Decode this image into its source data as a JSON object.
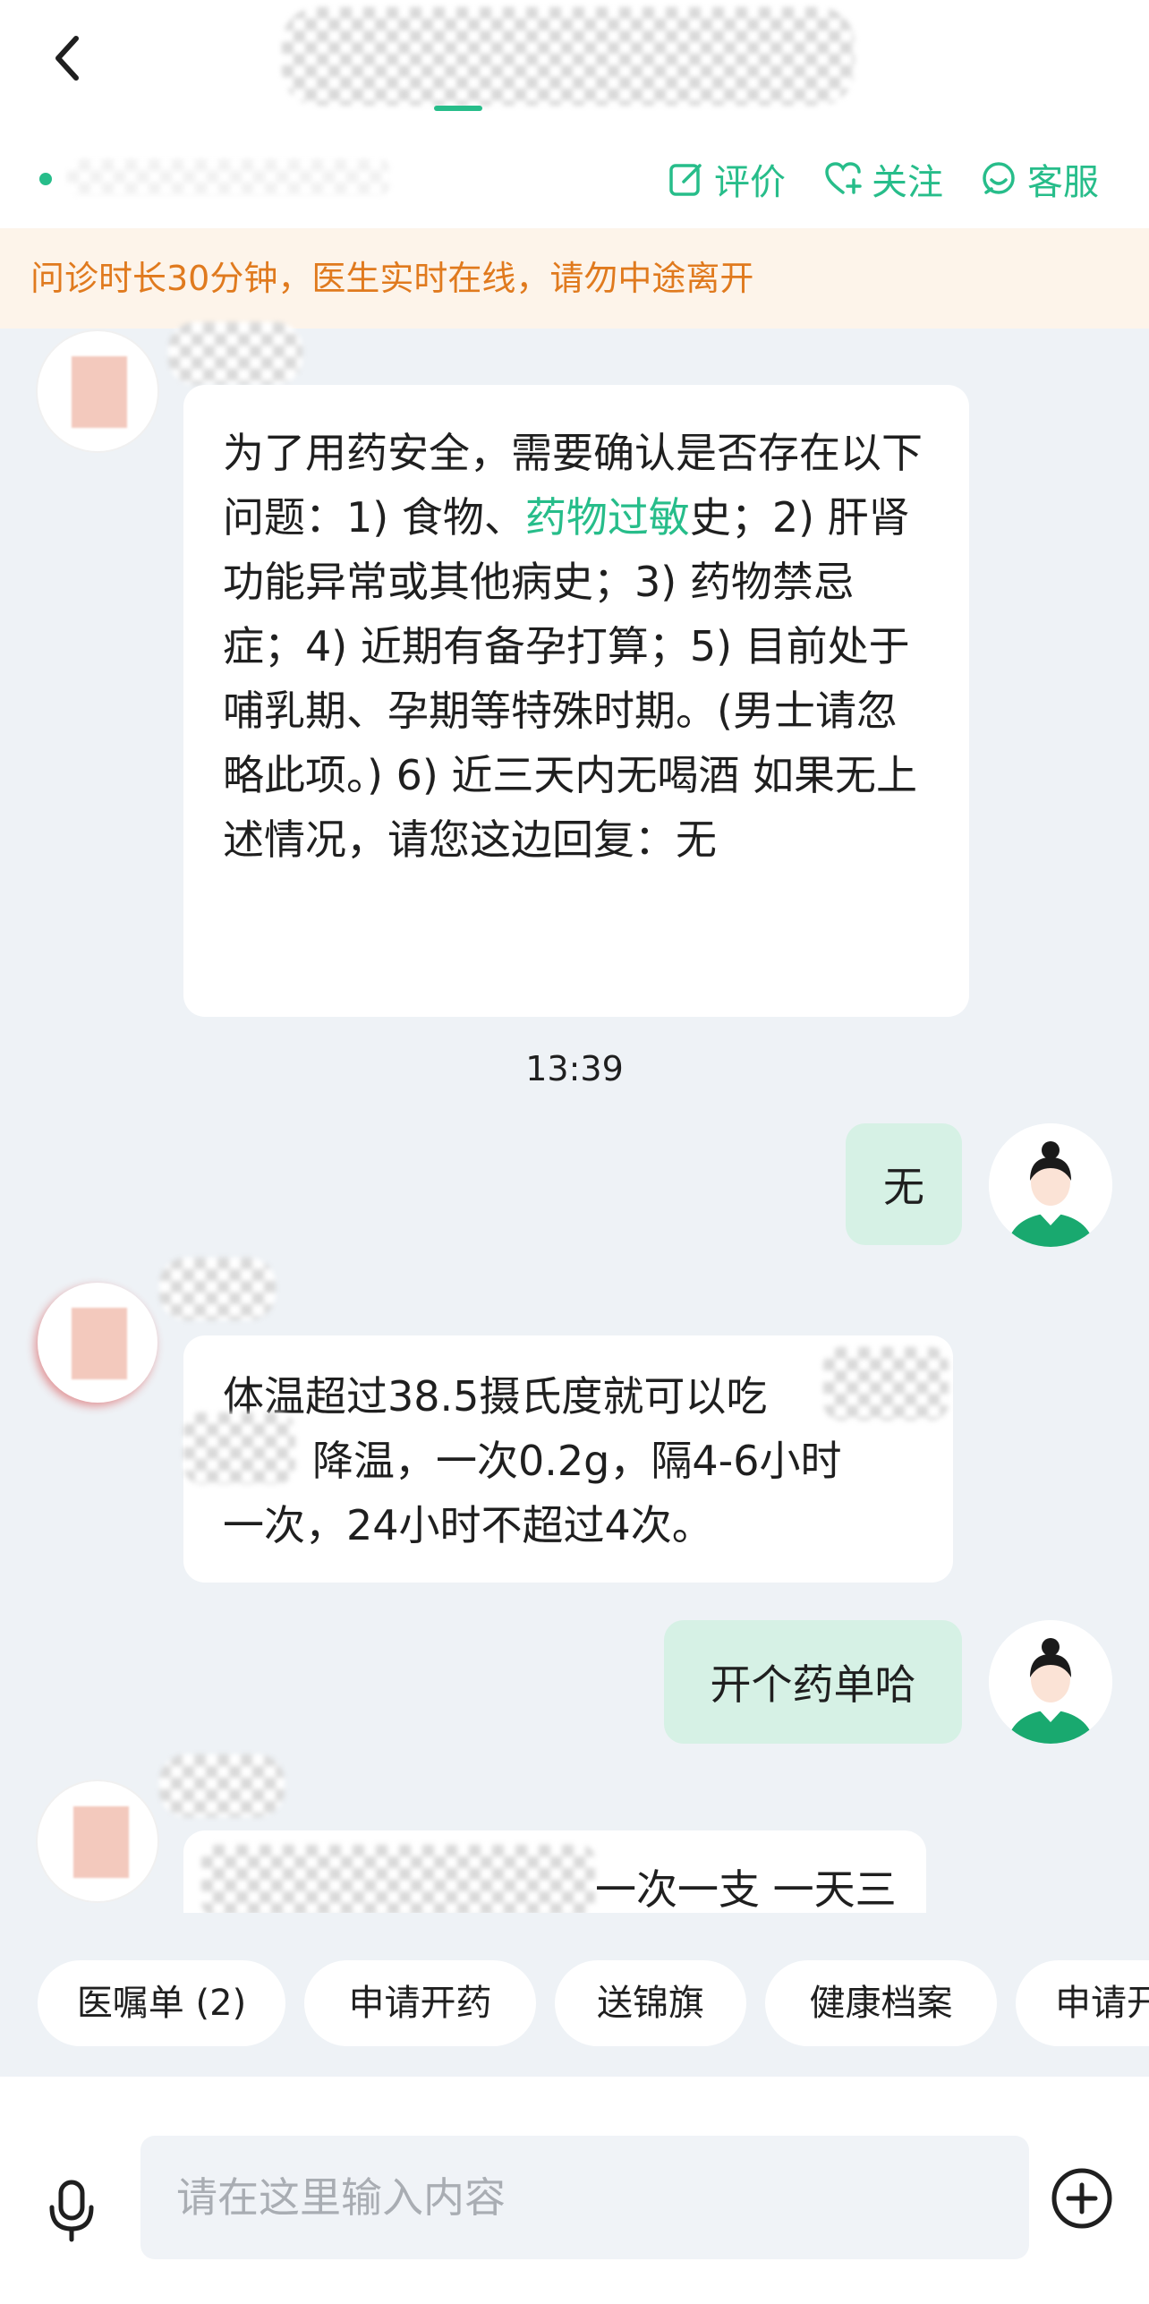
{
  "header": {
    "actions": [
      {
        "label": "评价",
        "icon": "edit-icon"
      },
      {
        "label": "关注",
        "icon": "heart-plus-icon"
      },
      {
        "label": "客服",
        "icon": "customer-service-icon"
      }
    ]
  },
  "notice": "问诊时长30分钟，医生实时在线，请勿中途离开",
  "messages": [
    {
      "from": "doctor",
      "text_before": "为了用药安全，需要确认是否存在以下问题：1) 食物、",
      "link": "药物过敏",
      "text_after": "史；2) 肝肾功能异常或其他病史；3) 药物禁忌症；4) 近期有备孕打算；5) 目前处于哺乳期、孕期等特殊时期。(男士请忽略此项。) 6) 近三天内无喝酒 如果无上述情况，请您这边回复：无"
    },
    {
      "from": "system",
      "timestamp": "13:39"
    },
    {
      "from": "user",
      "text": "无"
    },
    {
      "from": "doctor",
      "text_line1": "体温超过38.5摄氏度就可以吃",
      "text_line2_tail": "降温，一次0.2g，隔4-6小时",
      "text_line3": "一次，24小时不超过4次。"
    },
    {
      "from": "user",
      "text": "开个药单哈"
    },
    {
      "from": "doctor",
      "text_partial": "一次一支 一天三"
    }
  ],
  "quick_actions": [
    "医嘱单 (2)",
    "申请开药",
    "送锦旗",
    "健康档案",
    "申请开"
  ],
  "input": {
    "placeholder": "请在这里输入内容"
  },
  "colors": {
    "accent": "#27bd8a",
    "notice_text": "#e07a1e",
    "notice_bg": "#fdf4ea",
    "user_bubble": "#d6f1e5",
    "chat_bg": "#eef2f6"
  }
}
